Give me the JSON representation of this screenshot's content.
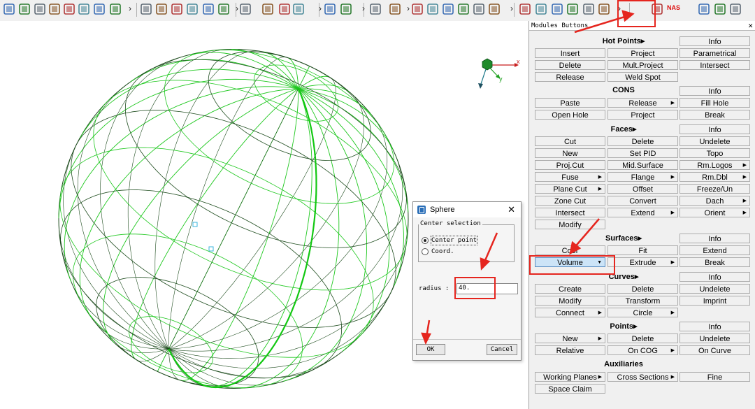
{
  "toolbar": {
    "icons": [
      "layers-icon",
      "pid-icon",
      "list-icon",
      "property-icon",
      "material-icon",
      "set-icon",
      "text-icon",
      "window-icon",
      "building-block-icon",
      "gear-icon",
      "documents-icon",
      "document-icon",
      "clipboard-icon",
      "group-icon",
      "monitor-icon",
      "checkbox-icon",
      "pencil-icon",
      "mesh-icon",
      "zoom-window-icon",
      "zoom-icon",
      "undo-icon",
      "redo-icon",
      "grid-icon",
      "table-icon",
      "trash-icon",
      "move-icon",
      "cylinder-icon",
      "transform-icon",
      "wrench-icon",
      "edit-icon",
      "align-icon",
      "flip-icon",
      "hammer-icon",
      "topo-icon",
      "mesh-box-icon",
      "nas-icon",
      "green-shape-icon",
      "stack-icon",
      "network-icon"
    ],
    "nas_label": "NAS"
  },
  "panel": {
    "title": "Modules Buttons",
    "hotpoints": {
      "title": "Hot Points▸",
      "info": "Info",
      "buttons": [
        "Insert",
        "Project",
        "Parametrical",
        "Delete",
        "Mult.Project",
        "Intersect",
        "Release",
        "Weld Spot"
      ]
    },
    "cons": {
      "title": "CONS",
      "info": "Info",
      "buttons": [
        "Paste",
        "Release",
        "Fill Hole",
        "Open Hole",
        "Project",
        "Break"
      ]
    },
    "faces": {
      "title": "Faces▸",
      "info": "Info",
      "buttons": [
        "Cut",
        "Delete",
        "Undelete",
        "New",
        "Set PID",
        "Topo",
        "Proj.Cut",
        "Mid.Surface",
        "Rm.Logos",
        "Fuse",
        "Flange",
        "Rm.Dbl",
        "Plane Cut",
        "Offset",
        "Freeze/Un",
        "Zone Cut",
        "Convert",
        "Dach",
        "Intersect",
        "Extend",
        "Orient",
        "Modify"
      ]
    },
    "surfaces": {
      "title": "Surfaces▸",
      "info": "Info",
      "buttons": [
        "Coor",
        "Fit",
        "Extend",
        "Volume",
        "Extrude",
        "Break"
      ]
    },
    "curves": {
      "title": "Curves▸",
      "info": "Info",
      "buttons": [
        "Create",
        "Delete",
        "Undelete",
        "Modify",
        "Transform",
        "Imprint",
        "Connect",
        "Circle"
      ]
    },
    "points": {
      "title": "Points▸",
      "info": "Info",
      "buttons": [
        "New",
        "Delete",
        "Undelete",
        "Relative",
        "On COG",
        "On Curve"
      ]
    },
    "auxiliaries": {
      "title": "Auxiliaries",
      "buttons": [
        "Working Planes",
        "Cross Sections",
        "Fine",
        "Space Claim"
      ]
    }
  },
  "dialog": {
    "title": "Sphere",
    "group_label": "Center selection",
    "option_center": "Center point",
    "option_coord": "Coord.",
    "selected_option": "Center point",
    "radius_label": "radius :",
    "radius_value": "40.",
    "ok": "OK",
    "cancel": "Cancel"
  },
  "axis": {
    "x_label": "x",
    "y_label": "y"
  },
  "colors": {
    "highlight": "#e5251e",
    "mesh_green": "#1fc81f",
    "mesh_dark": "#1f4d1f",
    "selected_button": "#cce4f7"
  }
}
